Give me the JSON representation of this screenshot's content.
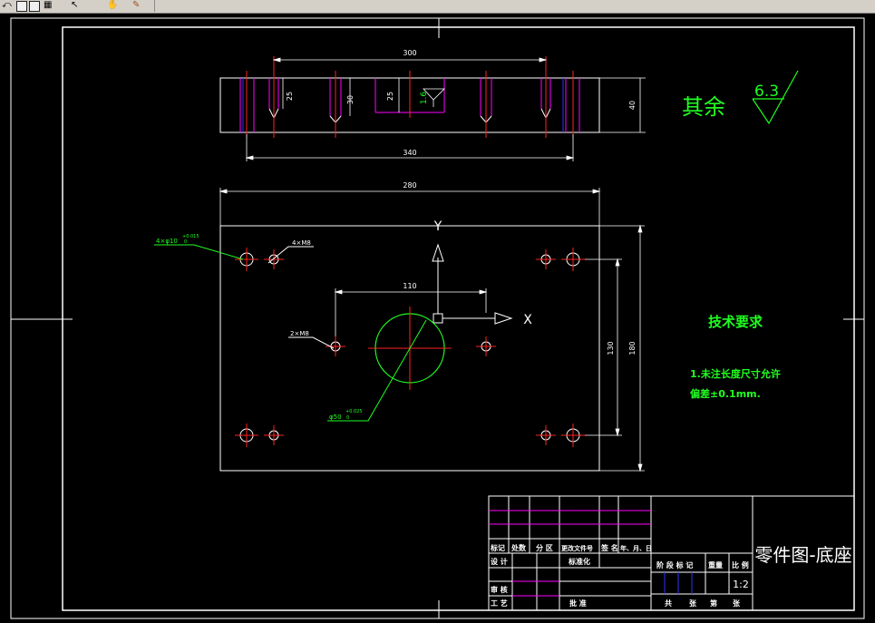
{
  "toolbar": {
    "icons": [
      "undo-icon",
      "window-icon",
      "window-icon",
      "properties-icon",
      "cursor-icon",
      "pan-icon",
      "match-icon"
    ]
  },
  "colors": {
    "background": "#000000",
    "lines": "#ffffff",
    "center": "#ff2020",
    "dims": "#ffffff",
    "green": "#20ff20",
    "magenta": "#ff00ff",
    "blue": "#3030ff"
  },
  "front_view": {
    "dim_top": "300",
    "dim_bottom": "340",
    "depth1": "25",
    "depth2": "30",
    "depth3": "25",
    "height": "40",
    "roughness": "1.6"
  },
  "roughness_note": {
    "label": "其余",
    "value": "6.3"
  },
  "plan_view": {
    "width": "280",
    "hole_spacing": "110",
    "inner_height": "130",
    "outer_height": "180",
    "hole_callout_1": "4×φ10",
    "hole_callout_1_tol": "+0.015",
    "hole_callout_1_tol2": "0",
    "hole_callout_2": "4×M8",
    "hole_callout_3": "2×M8",
    "bore_callout": "φ50",
    "bore_tol": "+0.025",
    "bore_tol2": "0",
    "axis_x": "X",
    "axis_y": "Y"
  },
  "tech_req": {
    "title": "技术要求",
    "line1": "1.未注长度尺寸允许",
    "line2": "偏差±0.1mm."
  },
  "title_block": {
    "part_name": "零件图-底座",
    "scale": "1:2",
    "headers": [
      "标记",
      "处数",
      "分 区",
      "更改文件号",
      "签 名",
      "年、月、日"
    ],
    "row_design": [
      "设 计",
      "标准化"
    ],
    "row_review": "审 核",
    "row_process": "工 艺",
    "approve": "批 准",
    "stage_mark": "阶 段 标 记",
    "weight": "重量",
    "ratio": "比 例",
    "sheets": [
      "共",
      "张",
      "第",
      "张"
    ]
  }
}
